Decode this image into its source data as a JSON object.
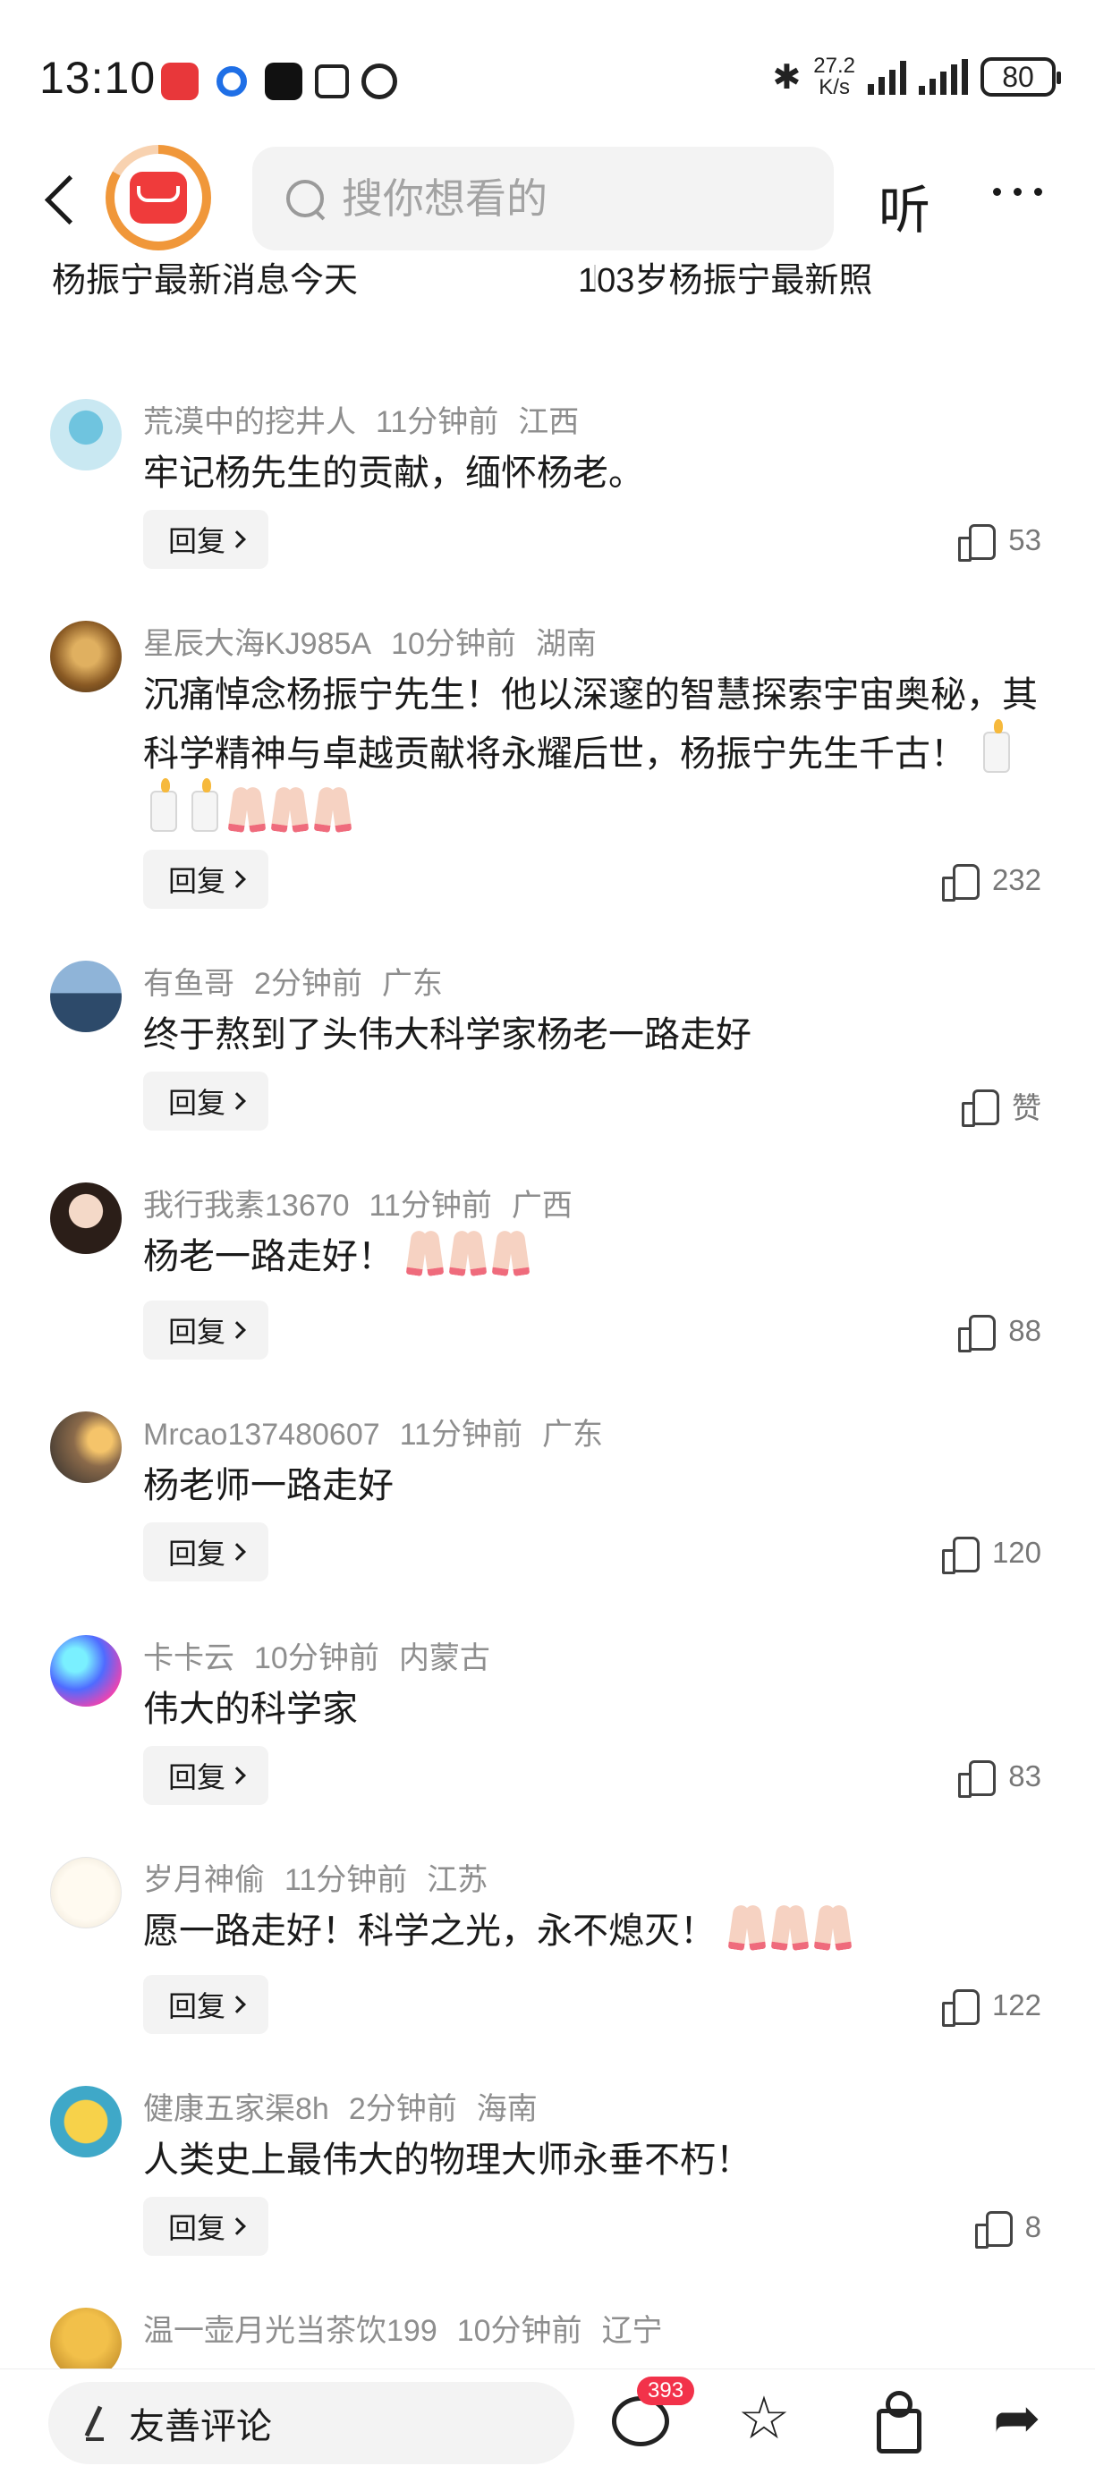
{
  "status_bar": {
    "time": "13:10",
    "net_speed_value": "27.2",
    "net_speed_unit": "K/s",
    "battery": "80",
    "app_icons": [
      "huawei-app-icon",
      "blue-circle-app-icon",
      "tiktok-icon",
      "nfc-icon",
      "alarm-icon"
    ]
  },
  "nav": {
    "search_placeholder": "搜你想看的",
    "listen_label": "听"
  },
  "related_searches": [
    "杨振宁最新消息今天",
    "103岁杨振宁最新照"
  ],
  "comments": [
    {
      "user": "荒漠中的挖井人",
      "time": "11分钟前",
      "location": "江西",
      "text": "牢记杨先生的贡献，缅怀杨老。",
      "likes": "53",
      "reply_label": "回复"
    },
    {
      "user": "星辰大海KJ985A",
      "time": "10分钟前",
      "location": "湖南",
      "text": "沉痛悼念杨振宁先生！他以深邃的智慧探索宇宙奥秘，其科学精神与卓越贡献将永耀后世，杨振宁先生千古！",
      "likes": "232",
      "reply_label": "回复"
    },
    {
      "user": "有鱼哥",
      "time": "2分钟前",
      "location": "广东",
      "text": "终于熬到了头伟大科学家杨老一路走好",
      "likes": "赞",
      "reply_label": "回复"
    },
    {
      "user": "我行我素13670",
      "time": "11分钟前",
      "location": "广西",
      "text": "杨老一路走好！",
      "likes": "88",
      "reply_label": "回复"
    },
    {
      "user": "Mrcao137480607",
      "time": "11分钟前",
      "location": "广东",
      "text": "杨老师一路走好",
      "likes": "120",
      "reply_label": "回复"
    },
    {
      "user": "卡卡云",
      "time": "10分钟前",
      "location": "内蒙古",
      "text": "伟大的科学家",
      "likes": "83",
      "reply_label": "回复"
    },
    {
      "user": "岁月神偷",
      "time": "11分钟前",
      "location": "江苏",
      "text": "愿一路走好！科学之光，永不熄灭！",
      "likes": "122",
      "reply_label": "回复"
    },
    {
      "user": "健康五家渠8h",
      "time": "2分钟前",
      "location": "海南",
      "text": "人类史上最伟大的物理大师永垂不朽！",
      "likes": "8",
      "reply_label": "回复"
    },
    {
      "user": "温一壶月光当茶饮199",
      "time": "10分钟前",
      "location": "辽宁"
    }
  ],
  "bottom_bar": {
    "comment_placeholder": "友善评论",
    "comment_count": "393"
  },
  "colors": {
    "accent_red": "#f2324a",
    "meta_gray": "#8e8e8e",
    "button_bg": "#f3f3f3"
  }
}
